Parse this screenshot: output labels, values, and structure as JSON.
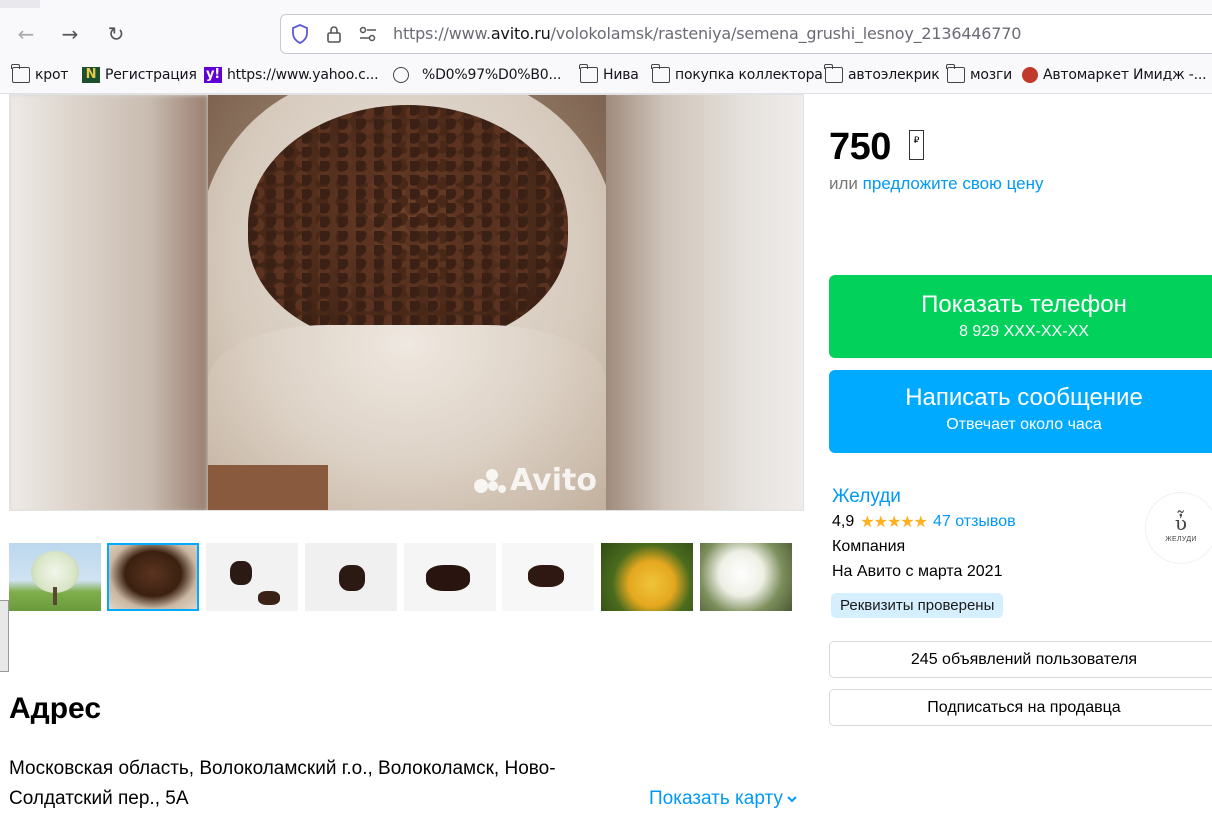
{
  "browser": {
    "url_prefix": "https://www.",
    "url_domain": "avito.ru",
    "url_path": "/volokolamsk/rasteniya/semena_grushi_lesnoy_2136446770",
    "bookmarks": [
      {
        "label": "крот",
        "icon": "folder-icon"
      },
      {
        "label": "Регистрация",
        "icon": "n-logo-icon"
      },
      {
        "label": "https://www.yahoo.c...",
        "icon": "yahoo-icon"
      },
      {
        "label": "%D0%97%D0%B0...",
        "icon": "globe-icon"
      },
      {
        "label": "Нива",
        "icon": "folder-icon"
      },
      {
        "label": "покупка коллектора",
        "icon": "folder-icon"
      },
      {
        "label": "автоэлекрик",
        "icon": "folder-icon"
      },
      {
        "label": "мозги",
        "icon": "folder-icon"
      },
      {
        "label": "Автомаркет Имидж -...",
        "icon": "site-icon"
      }
    ]
  },
  "listing": {
    "watermark": "Avito",
    "price": "750",
    "currency_symbol": "₽",
    "offer_prefix": "или",
    "offer_link": "предложите свою цену",
    "phone_button": {
      "title": "Показать телефон",
      "subtitle": "8 929 XXX-XX-XX"
    },
    "message_button": {
      "title": "Написать сообщение",
      "subtitle": "Отвечает около часа"
    },
    "seller": {
      "name": "Желуди",
      "rating": "4,9",
      "stars": "★★★★★",
      "reviews": "47 отзывов",
      "type": "Компания",
      "since": "На Авито с марта 2021",
      "badge": "Реквизиты проверены",
      "logo_text": "ЖЕЛУДИ"
    },
    "user_ads_button": "245 объявлений пользователя",
    "subscribe_button": "Подписаться на продавца",
    "address": {
      "title": "Адрес",
      "text": "Московская область, Волоколамский г.о., Волоколамск, Ново-Солдатский пер., 5А",
      "map_link": "Показать карту"
    }
  },
  "colors": {
    "green": "#02d15c",
    "blue": "#00aaff",
    "link": "#0099f7",
    "star": "#ffb021"
  }
}
